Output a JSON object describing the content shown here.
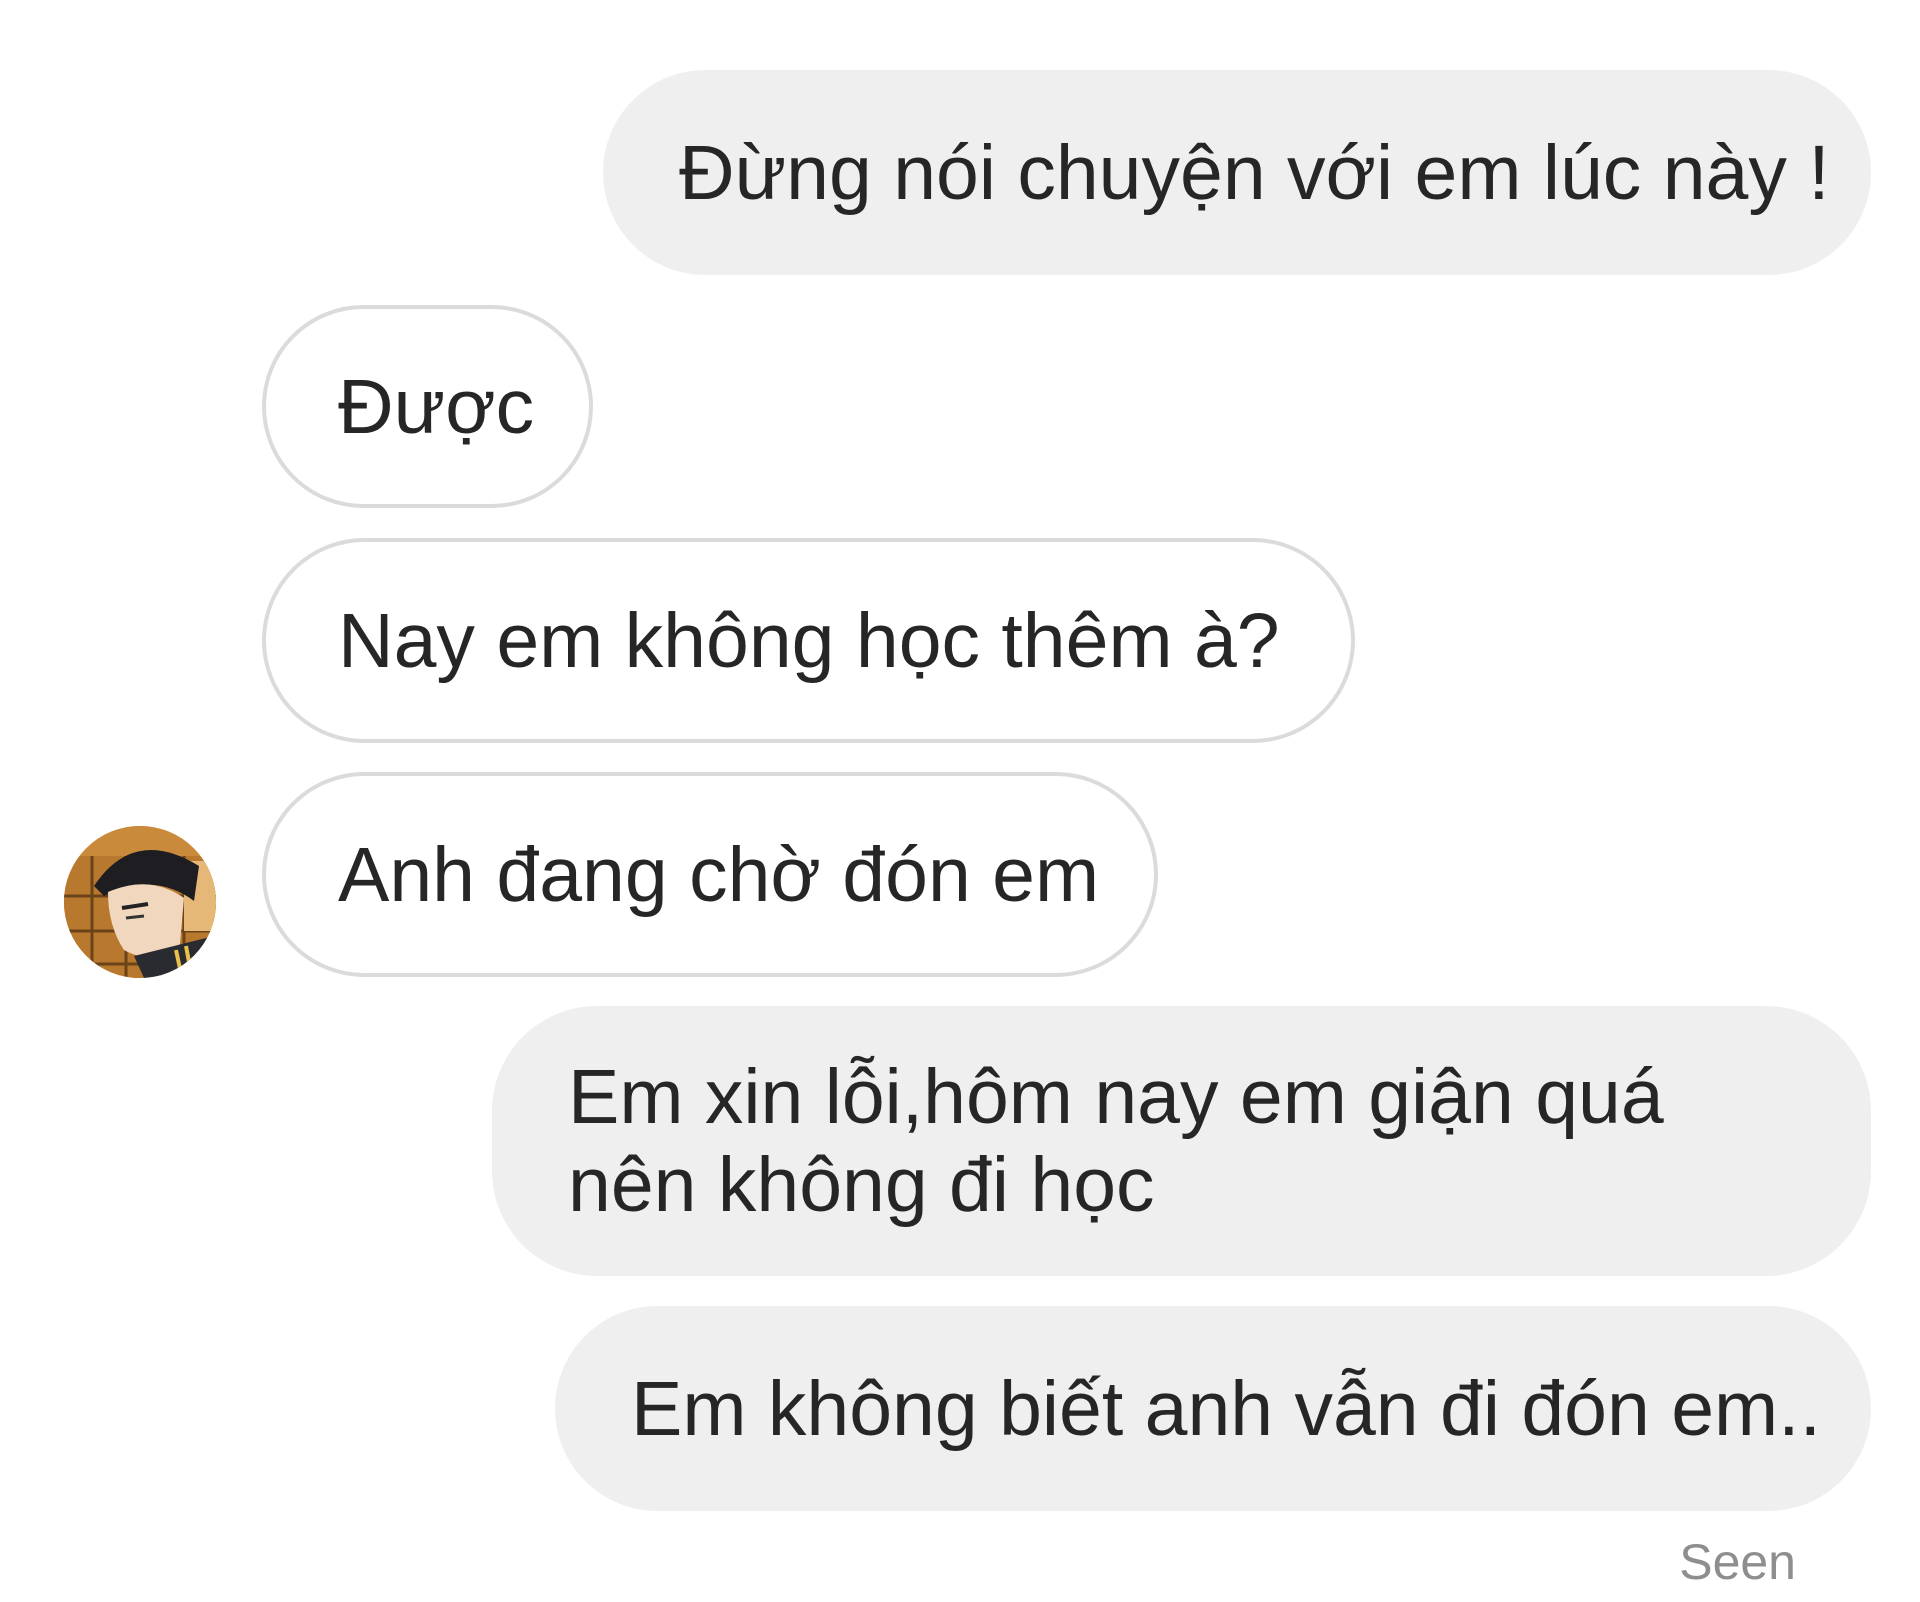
{
  "conversation": {
    "messages": [
      {
        "sender": "me",
        "text": "Đừng nói chuyện với em lúc này !"
      },
      {
        "sender": "other",
        "text": "Được"
      },
      {
        "sender": "other",
        "text": "Nay em không học thêm à?"
      },
      {
        "sender": "other",
        "text": "Anh đang chờ đón em"
      },
      {
        "sender": "me",
        "text": "Em xin lỗi,hôm nay em giận quá nên không đi học"
      },
      {
        "sender": "me",
        "text": "Em không biết anh vẫn đi đón em.."
      }
    ],
    "status": "Seen"
  },
  "colors": {
    "sent_bubble": "#efefef",
    "received_border": "#dbdbdb",
    "text": "#262626",
    "status_text": "#8e8e8e"
  },
  "icons": {
    "avatar": "contact-avatar"
  }
}
